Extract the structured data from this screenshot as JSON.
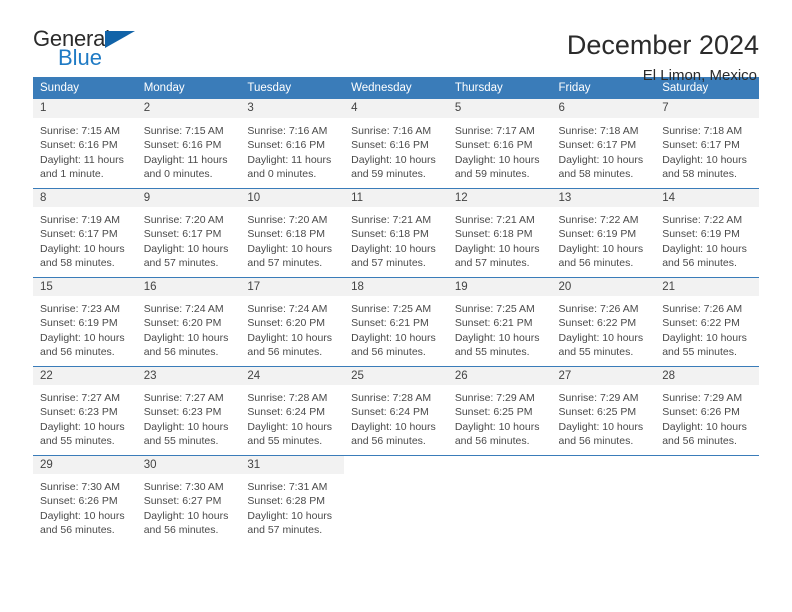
{
  "logo": {
    "word1": "General",
    "word2": "Blue",
    "flag_icon": "blue-triangle-flag-icon",
    "color_dark": "#2b2b2b",
    "color_blue": "#1f7ac4",
    "flag_color": "#1163a8"
  },
  "header": {
    "title": "December 2024",
    "subtitle": "El Limon, Mexico"
  },
  "theme": {
    "header_bg": "#3a7cb9",
    "daynum_bg": "#f2f2f2",
    "text": "#4a4a4a"
  },
  "calendar": {
    "weekdays": [
      "Sunday",
      "Monday",
      "Tuesday",
      "Wednesday",
      "Thursday",
      "Friday",
      "Saturday"
    ],
    "weeks": [
      [
        {
          "day": "1",
          "sunrise": "Sunrise: 7:15 AM",
          "sunset": "Sunset: 6:16 PM",
          "daylight1": "Daylight: 11 hours",
          "daylight2": "and 1 minute."
        },
        {
          "day": "2",
          "sunrise": "Sunrise: 7:15 AM",
          "sunset": "Sunset: 6:16 PM",
          "daylight1": "Daylight: 11 hours",
          "daylight2": "and 0 minutes."
        },
        {
          "day": "3",
          "sunrise": "Sunrise: 7:16 AM",
          "sunset": "Sunset: 6:16 PM",
          "daylight1": "Daylight: 11 hours",
          "daylight2": "and 0 minutes."
        },
        {
          "day": "4",
          "sunrise": "Sunrise: 7:16 AM",
          "sunset": "Sunset: 6:16 PM",
          "daylight1": "Daylight: 10 hours",
          "daylight2": "and 59 minutes."
        },
        {
          "day": "5",
          "sunrise": "Sunrise: 7:17 AM",
          "sunset": "Sunset: 6:16 PM",
          "daylight1": "Daylight: 10 hours",
          "daylight2": "and 59 minutes."
        },
        {
          "day": "6",
          "sunrise": "Sunrise: 7:18 AM",
          "sunset": "Sunset: 6:17 PM",
          "daylight1": "Daylight: 10 hours",
          "daylight2": "and 58 minutes."
        },
        {
          "day": "7",
          "sunrise": "Sunrise: 7:18 AM",
          "sunset": "Sunset: 6:17 PM",
          "daylight1": "Daylight: 10 hours",
          "daylight2": "and 58 minutes."
        }
      ],
      [
        {
          "day": "8",
          "sunrise": "Sunrise: 7:19 AM",
          "sunset": "Sunset: 6:17 PM",
          "daylight1": "Daylight: 10 hours",
          "daylight2": "and 58 minutes."
        },
        {
          "day": "9",
          "sunrise": "Sunrise: 7:20 AM",
          "sunset": "Sunset: 6:17 PM",
          "daylight1": "Daylight: 10 hours",
          "daylight2": "and 57 minutes."
        },
        {
          "day": "10",
          "sunrise": "Sunrise: 7:20 AM",
          "sunset": "Sunset: 6:18 PM",
          "daylight1": "Daylight: 10 hours",
          "daylight2": "and 57 minutes."
        },
        {
          "day": "11",
          "sunrise": "Sunrise: 7:21 AM",
          "sunset": "Sunset: 6:18 PM",
          "daylight1": "Daylight: 10 hours",
          "daylight2": "and 57 minutes."
        },
        {
          "day": "12",
          "sunrise": "Sunrise: 7:21 AM",
          "sunset": "Sunset: 6:18 PM",
          "daylight1": "Daylight: 10 hours",
          "daylight2": "and 57 minutes."
        },
        {
          "day": "13",
          "sunrise": "Sunrise: 7:22 AM",
          "sunset": "Sunset: 6:19 PM",
          "daylight1": "Daylight: 10 hours",
          "daylight2": "and 56 minutes."
        },
        {
          "day": "14",
          "sunrise": "Sunrise: 7:22 AM",
          "sunset": "Sunset: 6:19 PM",
          "daylight1": "Daylight: 10 hours",
          "daylight2": "and 56 minutes."
        }
      ],
      [
        {
          "day": "15",
          "sunrise": "Sunrise: 7:23 AM",
          "sunset": "Sunset: 6:19 PM",
          "daylight1": "Daylight: 10 hours",
          "daylight2": "and 56 minutes."
        },
        {
          "day": "16",
          "sunrise": "Sunrise: 7:24 AM",
          "sunset": "Sunset: 6:20 PM",
          "daylight1": "Daylight: 10 hours",
          "daylight2": "and 56 minutes."
        },
        {
          "day": "17",
          "sunrise": "Sunrise: 7:24 AM",
          "sunset": "Sunset: 6:20 PM",
          "daylight1": "Daylight: 10 hours",
          "daylight2": "and 56 minutes."
        },
        {
          "day": "18",
          "sunrise": "Sunrise: 7:25 AM",
          "sunset": "Sunset: 6:21 PM",
          "daylight1": "Daylight: 10 hours",
          "daylight2": "and 56 minutes."
        },
        {
          "day": "19",
          "sunrise": "Sunrise: 7:25 AM",
          "sunset": "Sunset: 6:21 PM",
          "daylight1": "Daylight: 10 hours",
          "daylight2": "and 55 minutes."
        },
        {
          "day": "20",
          "sunrise": "Sunrise: 7:26 AM",
          "sunset": "Sunset: 6:22 PM",
          "daylight1": "Daylight: 10 hours",
          "daylight2": "and 55 minutes."
        },
        {
          "day": "21",
          "sunrise": "Sunrise: 7:26 AM",
          "sunset": "Sunset: 6:22 PM",
          "daylight1": "Daylight: 10 hours",
          "daylight2": "and 55 minutes."
        }
      ],
      [
        {
          "day": "22",
          "sunrise": "Sunrise: 7:27 AM",
          "sunset": "Sunset: 6:23 PM",
          "daylight1": "Daylight: 10 hours",
          "daylight2": "and 55 minutes."
        },
        {
          "day": "23",
          "sunrise": "Sunrise: 7:27 AM",
          "sunset": "Sunset: 6:23 PM",
          "daylight1": "Daylight: 10 hours",
          "daylight2": "and 55 minutes."
        },
        {
          "day": "24",
          "sunrise": "Sunrise: 7:28 AM",
          "sunset": "Sunset: 6:24 PM",
          "daylight1": "Daylight: 10 hours",
          "daylight2": "and 55 minutes."
        },
        {
          "day": "25",
          "sunrise": "Sunrise: 7:28 AM",
          "sunset": "Sunset: 6:24 PM",
          "daylight1": "Daylight: 10 hours",
          "daylight2": "and 56 minutes."
        },
        {
          "day": "26",
          "sunrise": "Sunrise: 7:29 AM",
          "sunset": "Sunset: 6:25 PM",
          "daylight1": "Daylight: 10 hours",
          "daylight2": "and 56 minutes."
        },
        {
          "day": "27",
          "sunrise": "Sunrise: 7:29 AM",
          "sunset": "Sunset: 6:25 PM",
          "daylight1": "Daylight: 10 hours",
          "daylight2": "and 56 minutes."
        },
        {
          "day": "28",
          "sunrise": "Sunrise: 7:29 AM",
          "sunset": "Sunset: 6:26 PM",
          "daylight1": "Daylight: 10 hours",
          "daylight2": "and 56 minutes."
        }
      ],
      [
        {
          "day": "29",
          "sunrise": "Sunrise: 7:30 AM",
          "sunset": "Sunset: 6:26 PM",
          "daylight1": "Daylight: 10 hours",
          "daylight2": "and 56 minutes."
        },
        {
          "day": "30",
          "sunrise": "Sunrise: 7:30 AM",
          "sunset": "Sunset: 6:27 PM",
          "daylight1": "Daylight: 10 hours",
          "daylight2": "and 56 minutes."
        },
        {
          "day": "31",
          "sunrise": "Sunrise: 7:31 AM",
          "sunset": "Sunset: 6:28 PM",
          "daylight1": "Daylight: 10 hours",
          "daylight2": "and 57 minutes."
        },
        null,
        null,
        null,
        null
      ]
    ]
  }
}
